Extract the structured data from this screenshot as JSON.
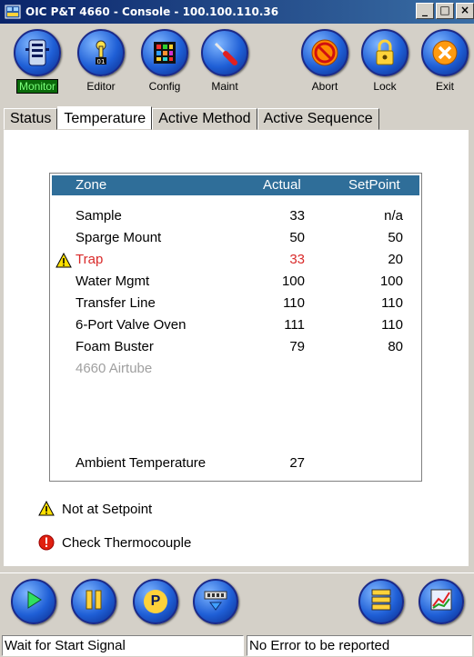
{
  "window": {
    "title": "OIC P&T 4660 - Console - 100.100.110.36",
    "minimize": "_",
    "maximize": "□",
    "close": "×"
  },
  "toolbar": [
    {
      "label": "Monitor",
      "icon": "server-icon",
      "active": true
    },
    {
      "label": "Editor",
      "icon": "thermometer-icon",
      "active": false
    },
    {
      "label": "Config",
      "icon": "grid-icon",
      "active": false
    },
    {
      "label": "Maint",
      "icon": "screwdriver-icon",
      "active": false
    },
    {
      "label": "Abort",
      "icon": "no-entry-icon",
      "active": false
    },
    {
      "label": "Lock",
      "icon": "padlock-icon",
      "active": false
    },
    {
      "label": "Exit",
      "icon": "x-icon",
      "active": false
    }
  ],
  "tabs": [
    {
      "label": "Status",
      "active": false
    },
    {
      "label": "Temperature",
      "active": true
    },
    {
      "label": "Active Method",
      "active": false
    },
    {
      "label": "Active Sequence",
      "active": false
    }
  ],
  "table": {
    "headers": {
      "zone": "Zone",
      "actual": "Actual",
      "setpoint": "SetPoint"
    },
    "rows": [
      {
        "zone": "Sample",
        "actual": "33",
        "setpoint": "n/a"
      },
      {
        "zone": "Sparge Mount",
        "actual": "50",
        "setpoint": "50"
      },
      {
        "zone": "Trap",
        "actual": "33",
        "setpoint": "20",
        "warning": true
      },
      {
        "zone": "Water Mgmt",
        "actual": "100",
        "setpoint": "100"
      },
      {
        "zone": "Transfer Line",
        "actual": "110",
        "setpoint": "110"
      },
      {
        "zone": "6-Port Valve Oven",
        "actual": "111",
        "setpoint": "110"
      },
      {
        "zone": "Foam Buster",
        "actual": "79",
        "setpoint": "80"
      },
      {
        "zone": "4660 Airtube",
        "actual": "",
        "setpoint": "",
        "disabled": true
      }
    ],
    "ambient": {
      "label": "Ambient Temperature",
      "actual": "27"
    }
  },
  "legend": {
    "not_at_setpoint": "Not at Setpoint",
    "check_thermocouple": "Check Thermocouple"
  },
  "bottom_buttons": [
    {
      "icon": "play-icon"
    },
    {
      "icon": "pause-icon"
    },
    {
      "icon": "p-icon",
      "text": "P"
    },
    {
      "icon": "transfer-icon"
    },
    {
      "icon": "stack-icon"
    },
    {
      "icon": "chart-icon"
    }
  ],
  "status": {
    "left": "Wait for Start Signal",
    "right": "No Error to be reported"
  },
  "colors": {
    "header_bg": "#2f6e99",
    "warning_text": "#d92a2a",
    "active_label_bg": "#0a6a0a",
    "active_label_fg": "#7cff7c"
  }
}
